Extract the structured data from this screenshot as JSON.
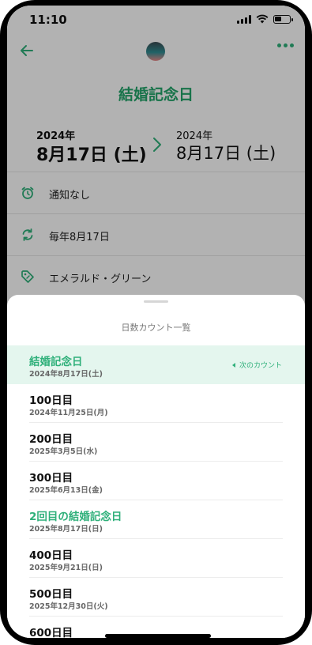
{
  "status": {
    "time": "11:10"
  },
  "event": {
    "title": "結婚記念日",
    "from": {
      "year": "2024年",
      "date": "8月17日 (土)"
    },
    "to": {
      "year": "2024年",
      "date": "8月17日 (土)"
    }
  },
  "details": [
    {
      "icon": "alarm-clock-icon",
      "label": "通知なし"
    },
    {
      "icon": "repeat-icon",
      "label": "毎年8月17日"
    },
    {
      "icon": "tag-icon",
      "label": "エメラルド・グリーン"
    }
  ],
  "sheet": {
    "title": "日数カウント一覧",
    "next_label": "次のカウント",
    "items": [
      {
        "name": "結婚記念日",
        "date": "2024年8月17日(土)"
      },
      {
        "name": "100日目",
        "date": "2024年11月25日(月)"
      },
      {
        "name": "200日目",
        "date": "2025年3月5日(水)"
      },
      {
        "name": "300日目",
        "date": "2025年6月13日(金)"
      },
      {
        "name": "2回目の結婚記念日",
        "date": "2025年8月17日(日)"
      },
      {
        "name": "400日目",
        "date": "2025年9月21日(日)"
      },
      {
        "name": "500日目",
        "date": "2025年12月30日(火)"
      },
      {
        "name": "600日目",
        "date": ""
      }
    ]
  },
  "colors": {
    "accent": "#2fb07a",
    "highlight": "#e4f6ee",
    "title_green": "#23a56b"
  }
}
